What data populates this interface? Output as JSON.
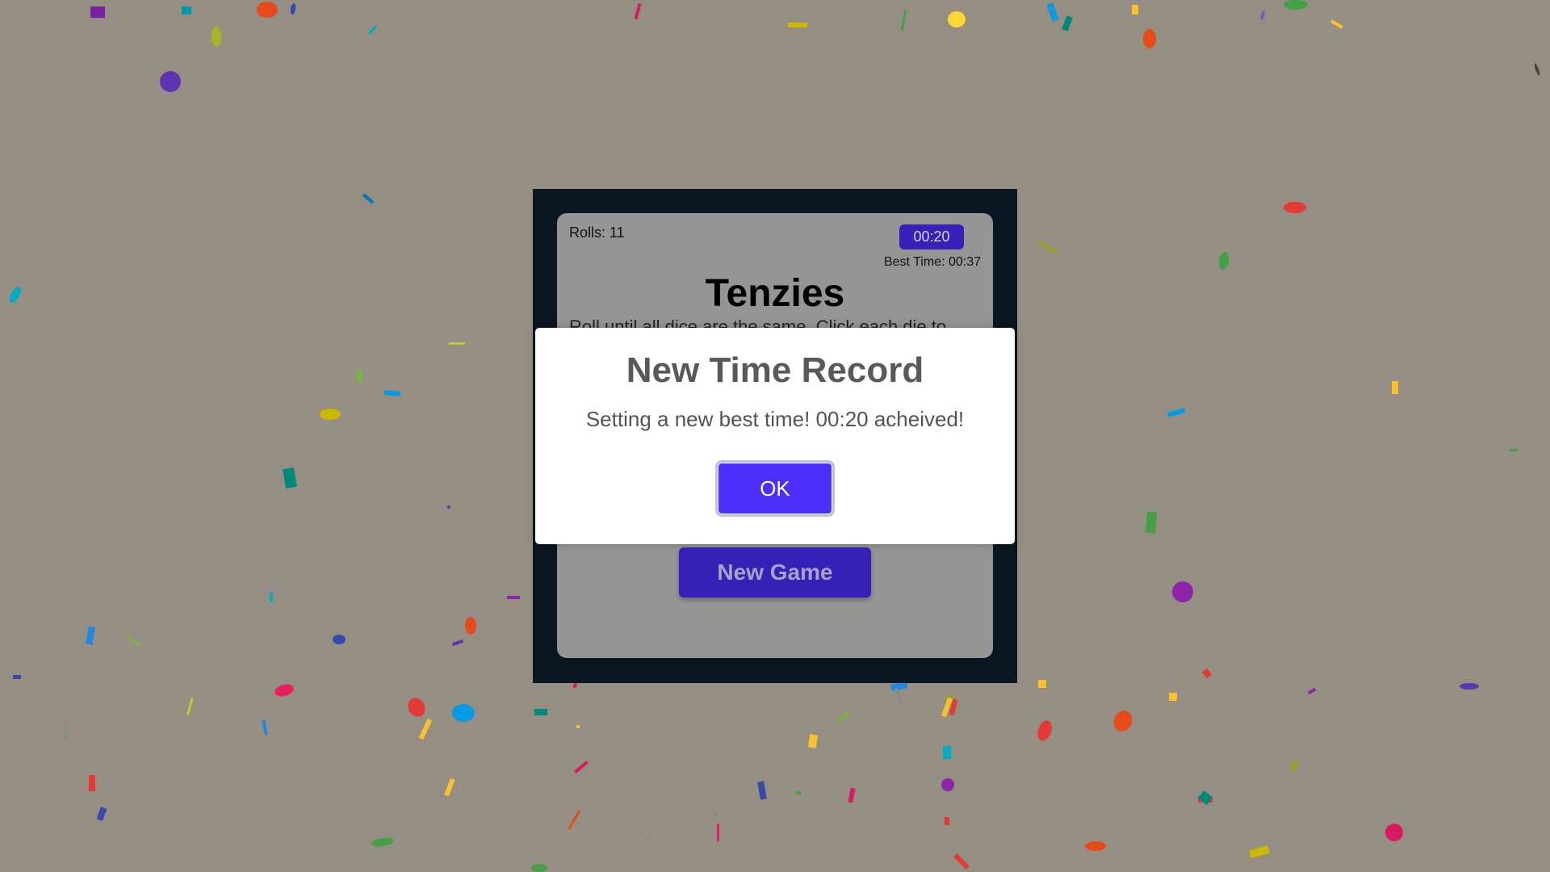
{
  "game": {
    "rolls_label": "Rolls: 11",
    "timer": "00:20",
    "best_time": "Best Time: 00:37",
    "title": "Tenzies",
    "instructions": "Roll until all dice are the same. Click each die to",
    "new_game_label": "New Game"
  },
  "modal": {
    "title": "New Time Record",
    "message": "Setting a new best time! 00:20 acheived!",
    "ok_label": "OK"
  },
  "colors": {
    "page_background": "#958e82",
    "frame": "#0a1620",
    "card": "#959595",
    "accent": "#3621b8",
    "ok_button": "#4c2ffb"
  }
}
